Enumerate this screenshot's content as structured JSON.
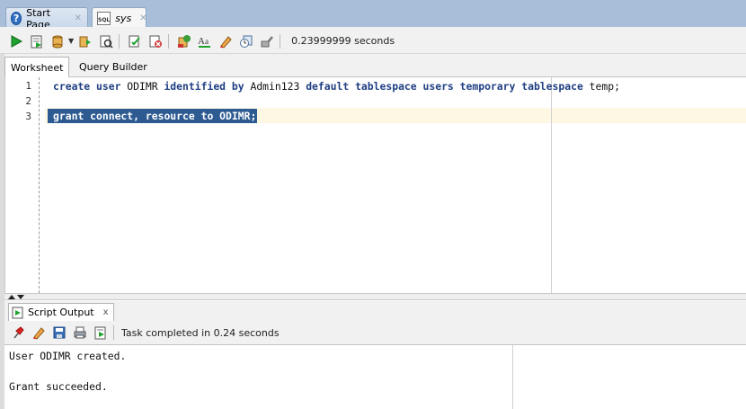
{
  "tabs": [
    {
      "label": "Start Page",
      "icon": "help-icon",
      "active": false
    },
    {
      "label": "sys",
      "icon": "sql-file-icon",
      "active": true,
      "icon_text": "SQL"
    }
  ],
  "toolbar": {
    "status": "0.23999999 seconds",
    "buttons": [
      "run-statement-icon",
      "run-script-icon",
      "commit-icon",
      "rollback-icon",
      "autotrace-icon",
      "explain-plan-icon",
      "sql-tuning-icon",
      "cancel-icon",
      "format-icon",
      "clear-icon",
      "history-icon",
      "tools-icon"
    ]
  },
  "worksheet_tabs": [
    {
      "label": "Worksheet",
      "active": true
    },
    {
      "label": "Query Builder",
      "active": false
    }
  ],
  "editor": {
    "lines": [
      {
        "number": "1",
        "keywords": "create user ",
        "ident": "ODIMR ",
        "keywords2": "identified by ",
        "ident2": "Admin123 ",
        "keywords3": "default tablespace users temporary tablespace ",
        "ident3": "temp;"
      },
      {
        "number": "2"
      },
      {
        "number": "3",
        "selected_text": "grant connect, resource to ODIMR;"
      }
    ]
  },
  "output": {
    "tab_label": "Script Output",
    "close_glyph": "x",
    "status": "Task completed in 0.24 seconds",
    "lines": [
      "User ODIMR created.",
      "",
      "Grant succeeded."
    ]
  },
  "colors": {
    "tabbar_bg": "#a9bed9",
    "keyword": "#1f3f83",
    "selection": "#2c5a91",
    "current_line": "#fdf7e3"
  }
}
